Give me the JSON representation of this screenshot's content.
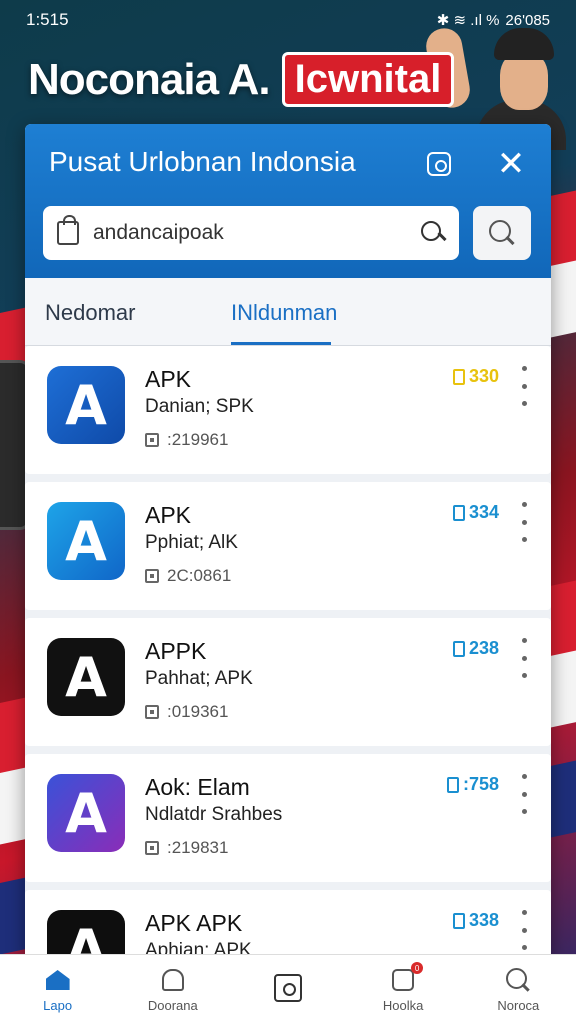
{
  "status_bar": {
    "time": "1:515",
    "icons": "✱ ≋ .ıl %",
    "battery": "26'085"
  },
  "headline": {
    "text": "Noconaia A.",
    "badge": "Icwnital"
  },
  "panel": {
    "title": "Pusat Urlobnan Indonsia",
    "search": {
      "value": "andancaipoak"
    }
  },
  "tabs": [
    {
      "label": "Nedomar"
    },
    {
      "label": "INldunman"
    }
  ],
  "apps": [
    {
      "name": "APK",
      "subtitle": "Danian; SPK",
      "meta": ":219961",
      "badge": "330",
      "badge_color": "gold",
      "icon_glyph": "A"
    },
    {
      "name": "APK",
      "subtitle": "Pphiat; AlK",
      "meta": "2C:0861",
      "badge": "334",
      "badge_color": "blue",
      "icon_glyph": "A"
    },
    {
      "name": "APPK",
      "subtitle": "Pahhat; APK",
      "meta": ":019361",
      "badge": "238",
      "badge_color": "blue",
      "icon_glyph": "A"
    },
    {
      "name": "Aok: Elam",
      "subtitle": "Ndlatdr Srahbes",
      "meta": ":219831",
      "badge": ":758",
      "badge_color": "blue",
      "icon_glyph": "A"
    },
    {
      "name": "APK APK",
      "subtitle": "Aphian: APK",
      "meta": "",
      "badge": "338",
      "badge_color": "blue",
      "icon_glyph": "A"
    }
  ],
  "bottom_nav": [
    {
      "label": "Lapo",
      "icon": "home-icon"
    },
    {
      "label": "Doorana",
      "icon": "bell-icon"
    },
    {
      "label": "",
      "icon": "camera-icon"
    },
    {
      "label": "Hoolka",
      "icon": "chat-icon",
      "badge": "0"
    },
    {
      "label": "Noroca",
      "icon": "search-icon"
    }
  ]
}
